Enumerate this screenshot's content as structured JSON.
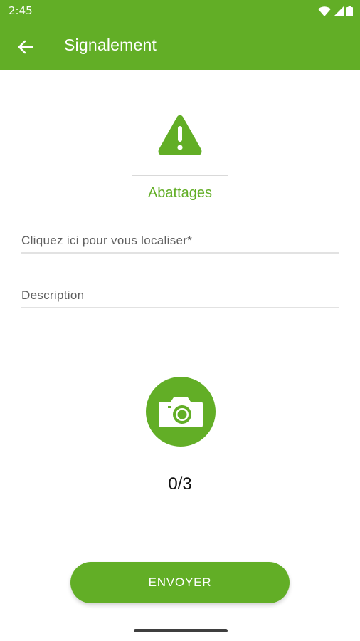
{
  "status_bar": {
    "time": "2:45",
    "icons": [
      "wifi-icon",
      "cell-signal-icon",
      "battery-icon"
    ]
  },
  "toolbar": {
    "back_icon": "arrow-left-icon",
    "title": "Signalement"
  },
  "category": {
    "icon": "warning-icon",
    "label": "Abattages"
  },
  "form": {
    "location_placeholder": "Cliquez ici pour vous localiser*",
    "description_placeholder": "Description"
  },
  "photos": {
    "icon": "camera-icon",
    "count_text": "0/3"
  },
  "actions": {
    "send_label": "ENVOYER"
  },
  "colors": {
    "brand_green": "#62ae26",
    "text_dark": "#111111",
    "placeholder": "#5f5f5f"
  }
}
